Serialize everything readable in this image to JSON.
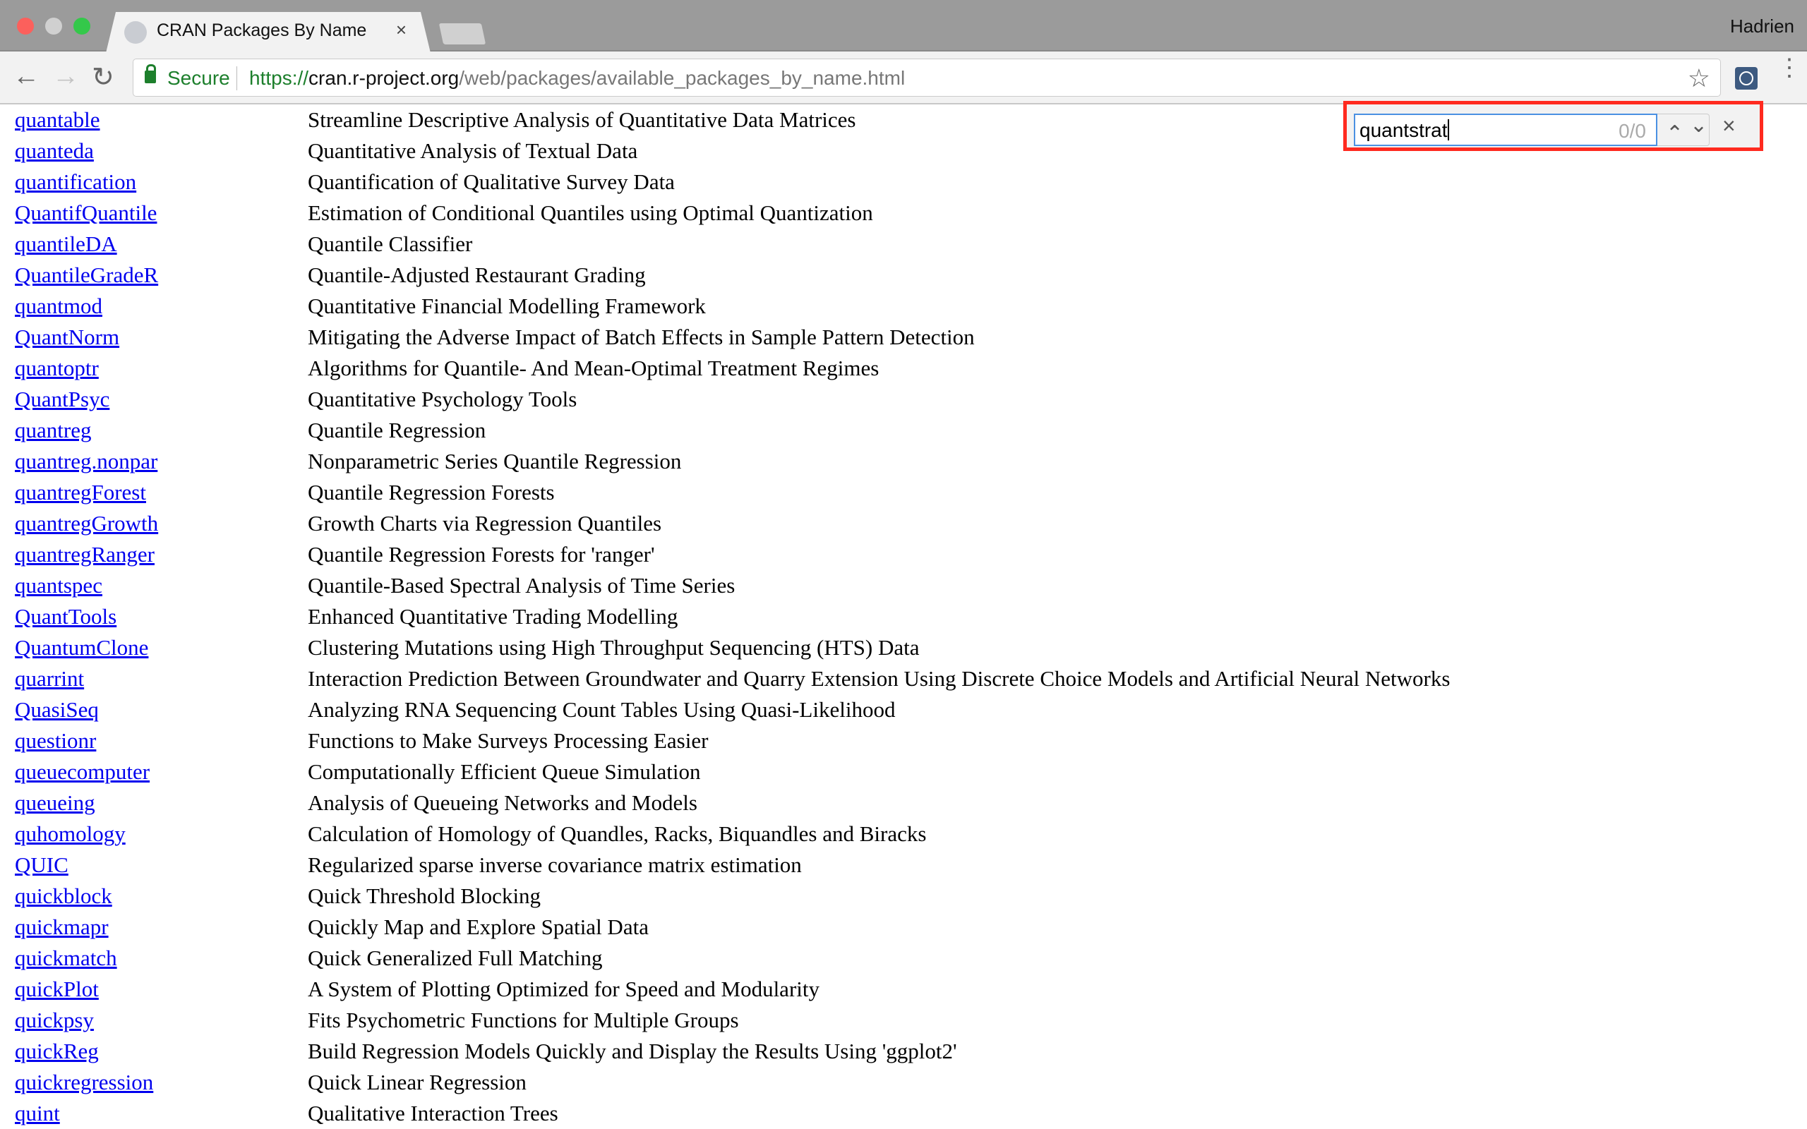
{
  "browser": {
    "tab_title": "CRAN Packages By Name",
    "tab_close": "×",
    "user": "Hadrien",
    "favicon": "R",
    "secure_label": "Secure",
    "url_scheme": "https://",
    "url_host": "cran.r-project.org",
    "url_path": "/web/packages/available_packages_by_name.html",
    "icons": {
      "back": "←",
      "forward": "→",
      "reload": "↻",
      "star": "☆",
      "menu": "⋮"
    }
  },
  "find": {
    "query": "quantstrat",
    "count": "0/0",
    "prev": "⌃",
    "next": "⌄",
    "close": "×",
    "highlight_color": "#ff2a1f"
  },
  "packages": [
    {
      "name": "quantable",
      "desc": "Streamline Descriptive Analysis of Quantitative Data Matrices"
    },
    {
      "name": "quanteda",
      "desc": "Quantitative Analysis of Textual Data"
    },
    {
      "name": "quantification",
      "desc": "Quantification of Qualitative Survey Data"
    },
    {
      "name": "QuantifQuantile",
      "desc": "Estimation of Conditional Quantiles using Optimal Quantization"
    },
    {
      "name": "quantileDA",
      "desc": "Quantile Classifier"
    },
    {
      "name": "QuantileGradeR",
      "desc": "Quantile-Adjusted Restaurant Grading"
    },
    {
      "name": "quantmod",
      "desc": "Quantitative Financial Modelling Framework"
    },
    {
      "name": "QuantNorm",
      "desc": "Mitigating the Adverse Impact of Batch Effects in Sample Pattern Detection"
    },
    {
      "name": "quantoptr",
      "desc": "Algorithms for Quantile- And Mean-Optimal Treatment Regimes"
    },
    {
      "name": "QuantPsyc",
      "desc": "Quantitative Psychology Tools"
    },
    {
      "name": "quantreg",
      "desc": "Quantile Regression"
    },
    {
      "name": "quantreg.nonpar",
      "desc": "Nonparametric Series Quantile Regression"
    },
    {
      "name": "quantregForest",
      "desc": "Quantile Regression Forests"
    },
    {
      "name": "quantregGrowth",
      "desc": "Growth Charts via Regression Quantiles"
    },
    {
      "name": "quantregRanger",
      "desc": "Quantile Regression Forests for 'ranger'"
    },
    {
      "name": "quantspec",
      "desc": "Quantile-Based Spectral Analysis of Time Series"
    },
    {
      "name": "QuantTools",
      "desc": "Enhanced Quantitative Trading Modelling"
    },
    {
      "name": "QuantumClone",
      "desc": "Clustering Mutations using High Throughput Sequencing (HTS) Data"
    },
    {
      "name": "quarrint",
      "desc": "Interaction Prediction Between Groundwater and Quarry Extension Using Discrete Choice Models and Artificial Neural Networks"
    },
    {
      "name": "QuasiSeq",
      "desc": "Analyzing RNA Sequencing Count Tables Using Quasi-Likelihood"
    },
    {
      "name": "questionr",
      "desc": "Functions to Make Surveys Processing Easier"
    },
    {
      "name": "queuecomputer",
      "desc": "Computationally Efficient Queue Simulation"
    },
    {
      "name": "queueing",
      "desc": "Analysis of Queueing Networks and Models"
    },
    {
      "name": "quhomology",
      "desc": "Calculation of Homology of Quandles, Racks, Biquandles and Biracks"
    },
    {
      "name": "QUIC",
      "desc": "Regularized sparse inverse covariance matrix estimation"
    },
    {
      "name": "quickblock",
      "desc": "Quick Threshold Blocking"
    },
    {
      "name": "quickmapr",
      "desc": "Quickly Map and Explore Spatial Data"
    },
    {
      "name": "quickmatch",
      "desc": "Quick Generalized Full Matching"
    },
    {
      "name": "quickPlot",
      "desc": "A System of Plotting Optimized for Speed and Modularity"
    },
    {
      "name": "quickpsy",
      "desc": "Fits Psychometric Functions for Multiple Groups"
    },
    {
      "name": "quickReg",
      "desc": "Build Regression Models Quickly and Display the Results Using 'ggplot2'"
    },
    {
      "name": "quickregression",
      "desc": "Quick Linear Regression"
    },
    {
      "name": "quint",
      "desc": "Qualitative Interaction Trees"
    }
  ]
}
